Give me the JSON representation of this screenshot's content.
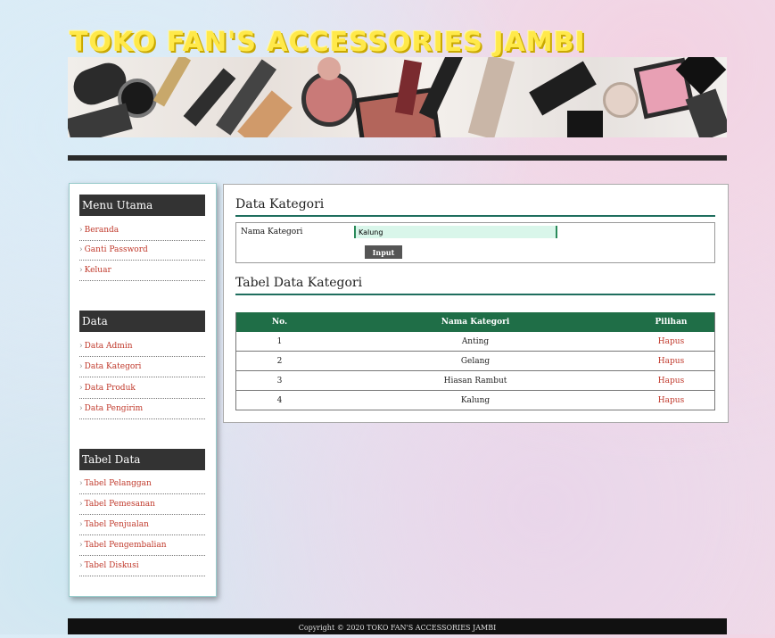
{
  "site": {
    "title": "TOKO FAN'S ACCESSORIES JAMBI"
  },
  "sidebar": {
    "sections": [
      {
        "heading": "Menu Utama",
        "items": [
          "Beranda",
          "Ganti Password",
          "Keluar"
        ]
      },
      {
        "heading": "Data",
        "items": [
          "Data Admin",
          "Data Kategori",
          "Data Produk",
          "Data Pengirim"
        ]
      },
      {
        "heading": "Tabel Data",
        "items": [
          "Tabel Pelanggan",
          "Tabel Pemesanan",
          "Tabel Penjualan",
          "Tabel Pengembalian",
          "Tabel Diskusi"
        ]
      }
    ]
  },
  "main": {
    "form_title": "Data Kategori",
    "form": {
      "label": "Nama Kategori",
      "value": "Kalung",
      "button": "Input"
    },
    "table_title": "Tabel Data Kategori",
    "table": {
      "headers": [
        "No.",
        "Nama Kategori",
        "Pilihan"
      ],
      "rows": [
        [
          "1",
          "Anting",
          "Hapus"
        ],
        [
          "2",
          "Gelang",
          "Hapus"
        ],
        [
          "3",
          "Hiasan Rambut",
          "Hapus"
        ],
        [
          "4",
          "Kalung",
          "Hapus"
        ]
      ]
    }
  },
  "footer": {
    "text": "Copyright © 2020 TOKO FAN'S ACCESSORIES JAMBI"
  },
  "colors": {
    "accent": "#1f6e47",
    "title": "#ffe94a",
    "link": "#c0392b",
    "header_bar": "#2a2a2a"
  }
}
